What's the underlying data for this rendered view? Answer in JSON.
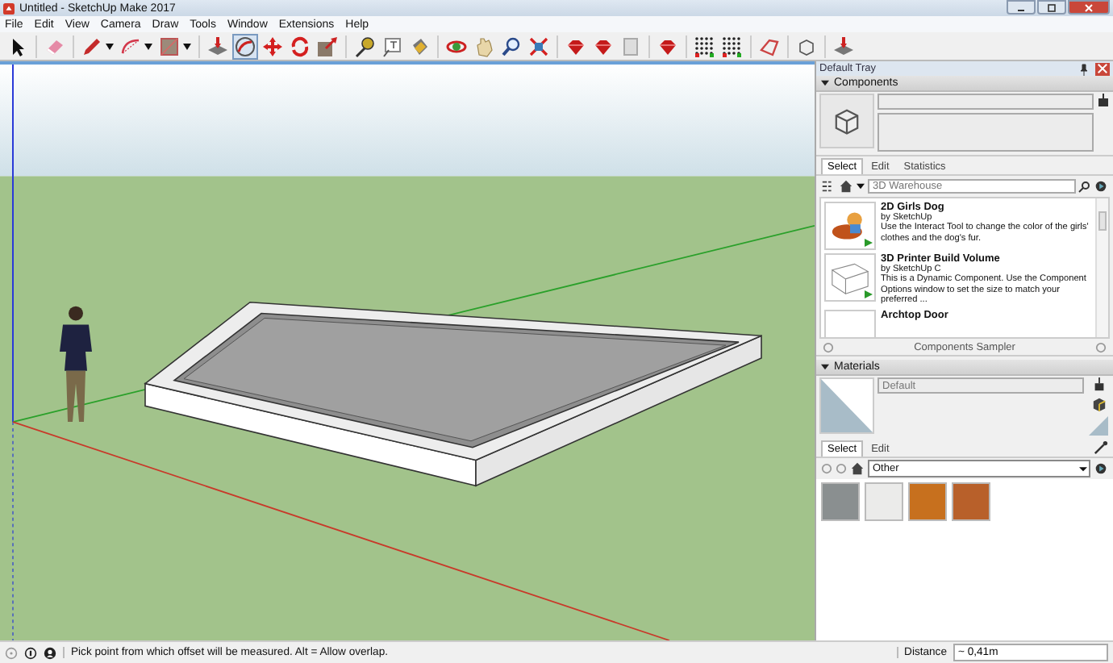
{
  "window": {
    "title": "Untitled - SketchUp Make 2017"
  },
  "menu": [
    "File",
    "Edit",
    "View",
    "Camera",
    "Draw",
    "Tools",
    "Window",
    "Extensions",
    "Help"
  ],
  "tray": {
    "title": "Default Tray",
    "components": {
      "title": "Components",
      "expanded": true,
      "tabs": [
        {
          "label": "Select",
          "selected": true
        },
        {
          "label": "Edit",
          "selected": false
        },
        {
          "label": "Statistics",
          "selected": false
        }
      ],
      "search": {
        "placeholder": "3D Warehouse"
      },
      "items": [
        {
          "name": "2D Girls Dog",
          "author": "by SketchUp",
          "description": "Use the Interact Tool to change the color of the girls' clothes and the dog's fur."
        },
        {
          "name": "3D Printer Build Volume",
          "author": "by SketchUp C",
          "description": "This is a Dynamic Component.  Use the Component Options window to set the size to match your preferred ..."
        },
        {
          "name": "Archtop Door"
        }
      ],
      "footer": "Components Sampler"
    },
    "materials": {
      "title": "Materials",
      "expanded": true,
      "name": "Default",
      "tabs": [
        {
          "label": "Select",
          "selected": true
        },
        {
          "label": "Edit",
          "selected": false
        }
      ],
      "library": "Other",
      "swatches": [
        {
          "color": "#8a8f90"
        },
        {
          "color": "#ebebea"
        },
        {
          "color": "#c7701e"
        },
        {
          "color": "#b8602a"
        }
      ]
    }
  },
  "status_bar": {
    "message": "Pick point from which offset will be measured. Alt = Allow overlap.",
    "measure_label": "Distance",
    "measure_value": "~ 0,41m"
  }
}
